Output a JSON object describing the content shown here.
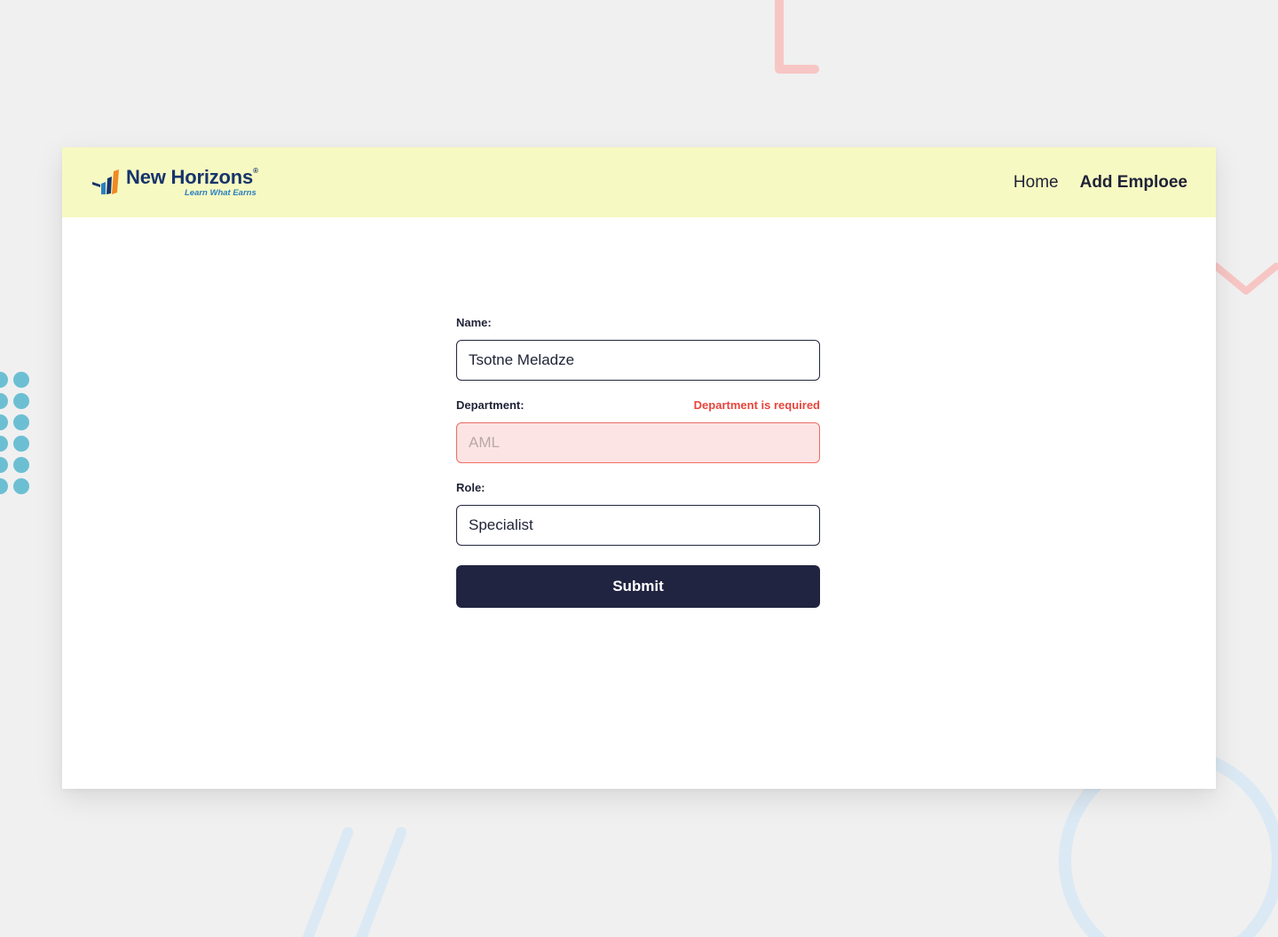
{
  "brand": {
    "name": "New Horizons",
    "trademark": "®",
    "tagline": "Learn What Earns"
  },
  "nav": {
    "items": [
      {
        "label": "Home",
        "active": false
      },
      {
        "label": "Add Emploee",
        "active": true
      }
    ]
  },
  "form": {
    "name": {
      "label": "Name:",
      "value": "Tsotne Meladze"
    },
    "department": {
      "label": "Department:",
      "value": "",
      "placeholder": "AML",
      "error": "Department is required"
    },
    "role": {
      "label": "Role:",
      "value": "Specialist"
    },
    "submit_label": "Submit"
  },
  "colors": {
    "background": "#f0f0f0",
    "navbar": "#f7f9c2",
    "primary_dark": "#212440",
    "error": "#e8453c",
    "error_bg": "#fde4e4",
    "brand_blue": "#17346b",
    "brand_orange": "#f08a24",
    "deco_pink": "#f7c6c4",
    "deco_teal": "#6cbfd3",
    "deco_lightblue": "#dbe9f4"
  }
}
